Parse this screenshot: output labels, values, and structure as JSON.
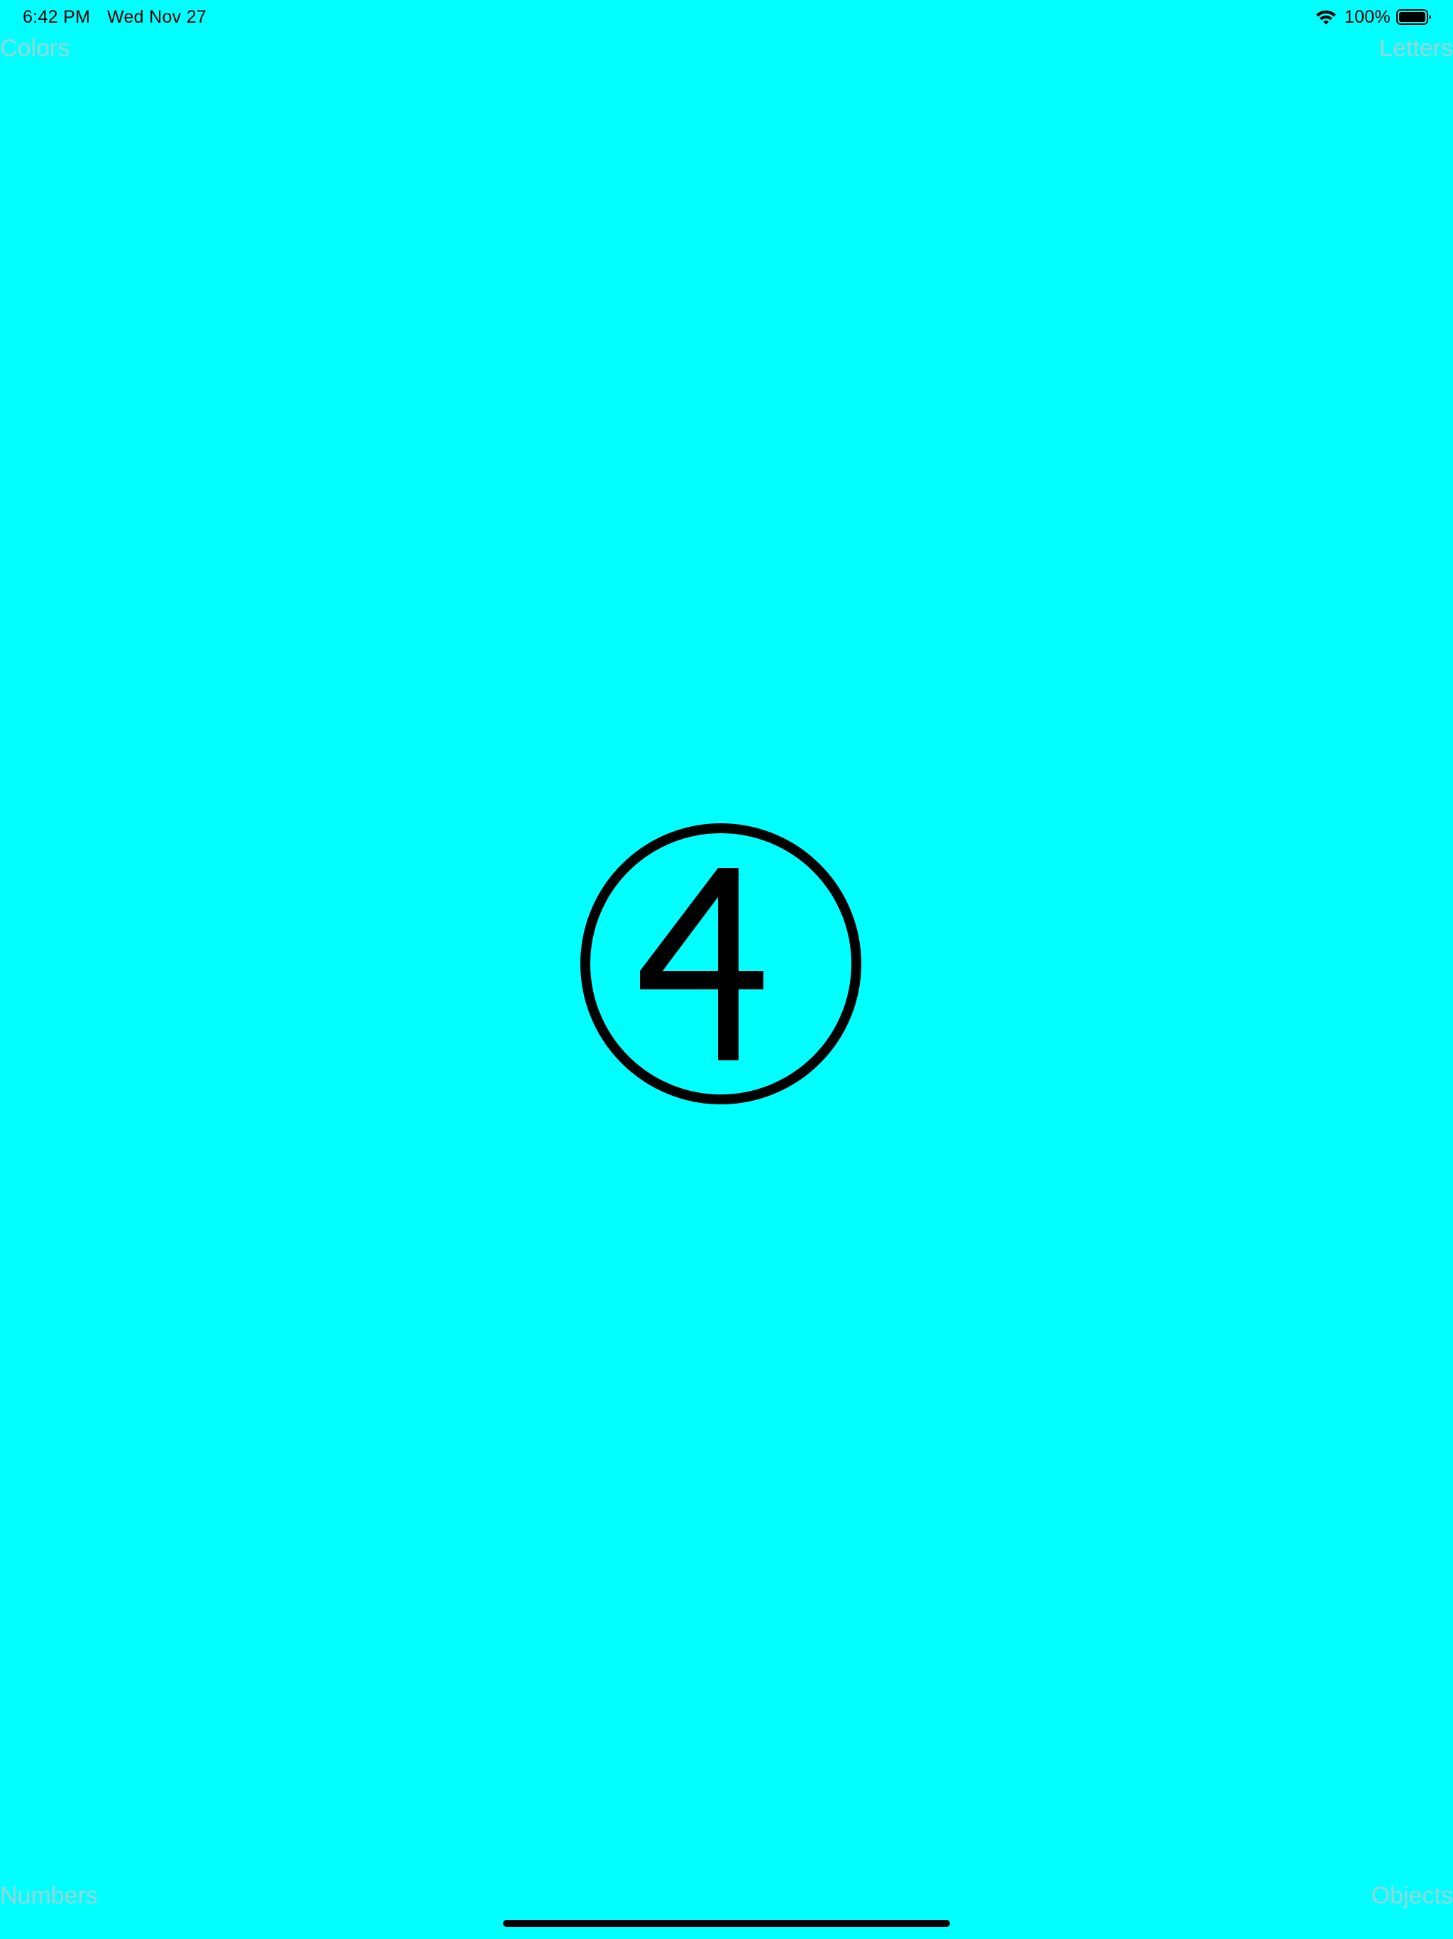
{
  "colors": {
    "background": "#00FFFF",
    "foreground": "#000000",
    "corner_label": "#9ED2D6"
  },
  "status_bar": {
    "time": "6:42 PM",
    "date": "Wed Nov 27",
    "battery_percent": "100%",
    "wifi_icon": "wifi-icon",
    "battery_icon": "battery-full-icon",
    "battery_level": 1.0
  },
  "corners": {
    "top_left": "Colors",
    "top_right": "Letters",
    "bottom_left": "Numbers",
    "bottom_right": "Objects"
  },
  "center": {
    "numeral": "4",
    "icon": "circled-number-icon"
  }
}
